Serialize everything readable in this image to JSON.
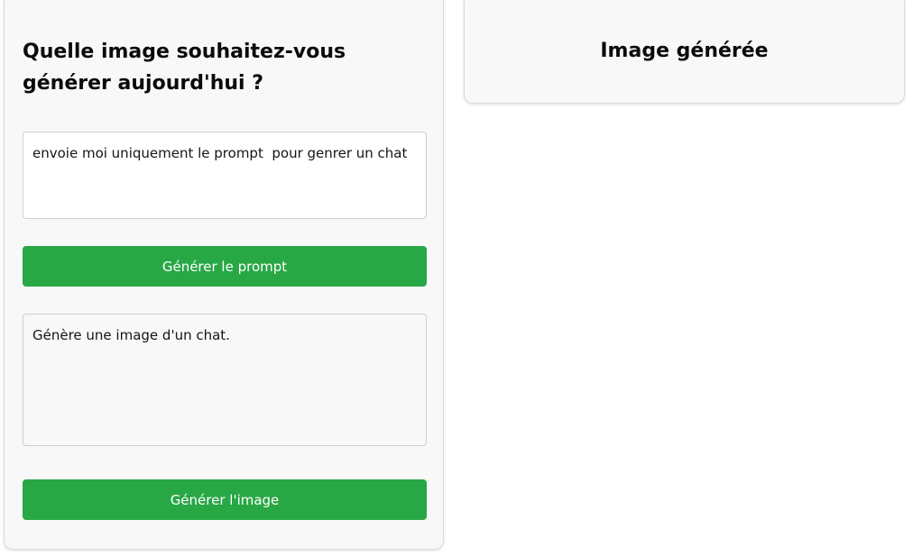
{
  "left_panel": {
    "heading": "Quelle image souhaitez-vous générer aujourd'hui ?",
    "user_input": "envoie moi uniquement le prompt  pour genrer un chat",
    "generate_prompt_button": "Générer le prompt",
    "generated_prompt": "Génère une image d'un chat.",
    "generate_image_button": "Générer l'image"
  },
  "right_panel": {
    "heading": "Image générée"
  },
  "colors": {
    "button_green": "#28a745",
    "panel_background": "#f8f8f8"
  }
}
